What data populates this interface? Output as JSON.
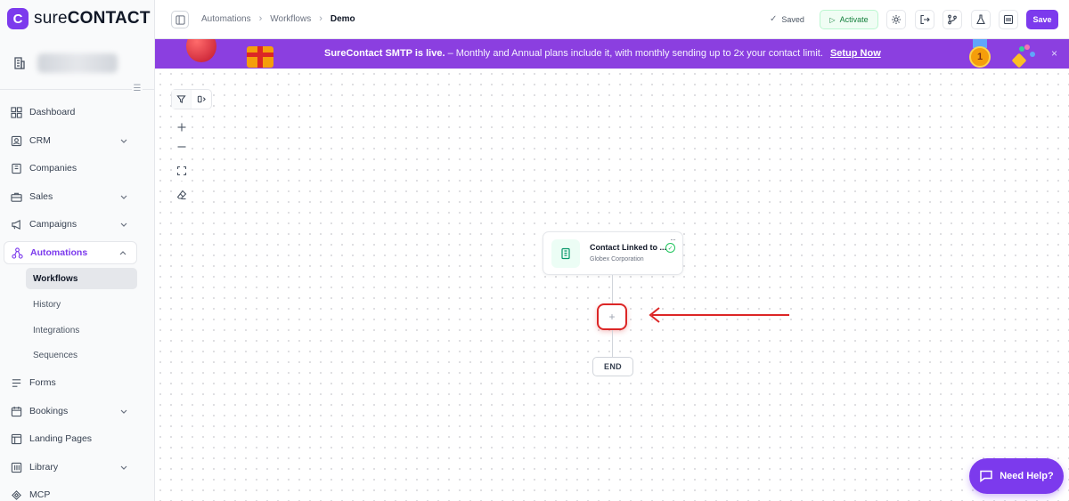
{
  "app": {
    "logo_mark": "C",
    "logo_prefix": "sure",
    "logo_suffix": "CONTACT"
  },
  "sidebar": {
    "items": [
      {
        "label": "Dashboard",
        "icon": "dashboard-icon"
      },
      {
        "label": "CRM",
        "icon": "crm-icon"
      },
      {
        "label": "Companies",
        "icon": "companies-icon"
      },
      {
        "label": "Sales",
        "icon": "sales-icon"
      },
      {
        "label": "Campaigns",
        "icon": "megaphone-icon"
      },
      {
        "label": "Automations",
        "icon": "automations-icon"
      },
      {
        "label": "Forms",
        "icon": "forms-icon"
      },
      {
        "label": "Bookings",
        "icon": "calendar-icon"
      },
      {
        "label": "Landing Pages",
        "icon": "landing-pages-icon"
      },
      {
        "label": "Library",
        "icon": "library-icon"
      },
      {
        "label": "MCP",
        "icon": "mcp-icon"
      }
    ],
    "automations_sub": [
      "Workflows",
      "History",
      "Integrations",
      "Sequences"
    ],
    "active_item": "Automations",
    "active_sub": "Workflows"
  },
  "breadcrumb": {
    "items": [
      "Automations",
      "Workflows",
      "Demo"
    ]
  },
  "toolbar": {
    "saved_label": "Saved",
    "activate_label": "Activate",
    "save_label": "Save"
  },
  "banner": {
    "headline": "SureContact SMTP is live.",
    "message": "– Monthly and Annual plans include it, with monthly sending up to 2x your contact limit.",
    "cta": "Setup Now",
    "medal_number": "1",
    "close": "×"
  },
  "canvas": {
    "node": {
      "title": "Contact Linked to ...",
      "subtitle": "Globex Corporation"
    },
    "add_symbol": "+",
    "end_label": "END"
  },
  "help": {
    "label": "Need Help?"
  },
  "colors": {
    "brand": "#7c3aed",
    "banner": "#8b3fe0",
    "activate": "#15803d",
    "highlight": "#dc2626"
  }
}
